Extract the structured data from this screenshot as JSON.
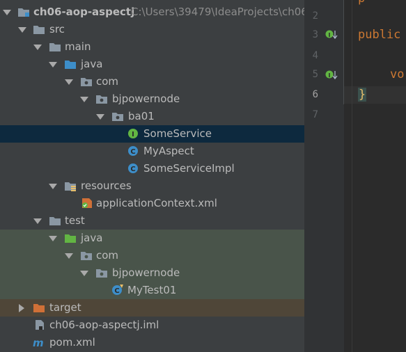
{
  "project": {
    "root_name": "ch06-aop-aspectj",
    "root_path": "C:\\Users\\39479\\IdeaProjects\\ch06"
  },
  "tree": {
    "src": "src",
    "main": "main",
    "java_main": "java",
    "com_main": "com",
    "bjpowernode_main": "bjpowernode",
    "ba01": "ba01",
    "some_service": "SomeService",
    "my_aspect": "MyAspect",
    "some_service_impl": "SomeServiceImpl",
    "resources": "resources",
    "app_context": "applicationContext.xml",
    "test": "test",
    "java_test": "java",
    "com_test": "com",
    "bjpowernode_test": "bjpowernode",
    "my_test": "MyTest01",
    "target": "target",
    "iml": "ch06-aop-aspectj.iml",
    "pom": "pom.xml"
  },
  "editor": {
    "line_numbers": [
      "2",
      "3",
      "4",
      "5",
      "6",
      "7"
    ],
    "current_line": "6",
    "code_line3": "public",
    "code_line5": "vo",
    "code_line6": "}"
  },
  "colors": {
    "tree_bg": "#3c3f41",
    "selection": "#0d293e",
    "test_root_bg": "#49544a",
    "excluded_bg": "#4f4638",
    "keyword": "#cc7832",
    "folder": "#8a97a3",
    "source_folder": "#3d8ec9",
    "test_folder": "#62b543",
    "excluded_folder": "#d07037"
  }
}
